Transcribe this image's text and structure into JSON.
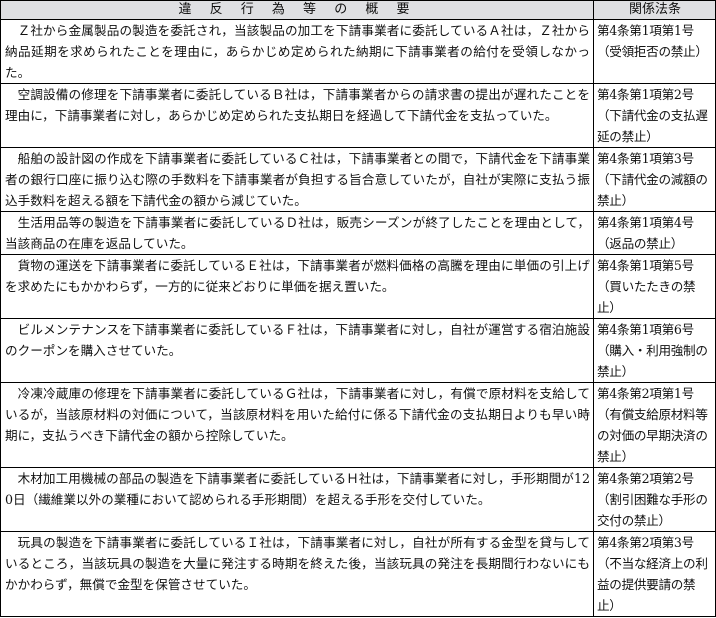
{
  "table": {
    "headers": [
      "違 反 行 為 等 の 概 要",
      "関係法条"
    ],
    "rows": [
      {
        "summary": "Ｚ社から金属製品の製造を委託され，当該製品の加工を下請事業者に委託しているＡ社は，Ｚ社から納品延期を求められたことを理由に，あらかじめ定められた納期に下請事業者の給付を受領しなかった。",
        "law": "第4条第1項第1号（受領拒否の禁止）"
      },
      {
        "summary": "空調設備の修理を下請事業者に委託しているＢ社は，下請事業者からの請求書の提出が遅れたことを理由に，下請事業者に対し，あらかじめ定められた支払期日を経過して下請代金を支払っていた。",
        "law": "第4条第1項第2号（下請代金の支払遅延の禁止）"
      },
      {
        "summary": "船舶の設計図の作成を下請事業者に委託しているＣ社は，下請事業者との間で，下請代金を下請事業者の銀行口座に振り込む際の手数料を下請事業者が負担する旨合意していたが，自社が実際に支払う振込手数料を超える額を下請代金の額から減じていた。",
        "law": "第4条第1項第3号（下請代金の減額の禁止）"
      },
      {
        "summary": "生活用品等の製造を下請事業者に委託しているＤ社は，販売シーズンが終了したことを理由として，当該商品の在庫を返品していた。",
        "law": "第4条第1項第4号（返品の禁止）"
      },
      {
        "summary": "貨物の運送を下請事業者に委託しているＥ社は，下請事業者が燃料価格の高騰を理由に単価の引上げを求めたにもかかわらず，一方的に従来どおりに単価を据え置いた。",
        "law": "第4条第1項第5号（買いたたきの禁止）"
      },
      {
        "summary": "ビルメンテナンスを下請事業者に委託しているＦ社は，下請事業者に対し，自社が運営する宿泊施設のクーポンを購入させていた。",
        "law": "第4条第1項第6号（購入・利用強制の禁止）"
      },
      {
        "summary": "冷凍冷蔵庫の修理を下請事業者に委託しているＧ社は，下請事業者に対し，有償で原材料を支給しているが，当該原材料の対価について，当該原材料を用いた給付に係る下請代金の支払期日よりも早い時期に，支払うべき下請代金の額から控除していた。",
        "law": "第4条第2項第1号（有償支給原材料等の対価の早期決済の禁止）"
      },
      {
        "summary": "木材加工用機械の部品の製造を下請事業者に委託しているＨ社は，下請事業者に対し，手形期間が120日（繊維業以外の業種において認められる手形期間）を超える手形を交付していた。",
        "law": "第4条第2項第2号（割引困難な手形の交付の禁止）"
      },
      {
        "summary": "玩具の製造を下請事業者に委託しているＩ社は，下請事業者に対し，自社が所有する金型を貸与しているところ，当該玩具の製造を大量に発注する時期を終えた後，当該玩具の発注を長期間行わないにもかかわらず，無償で金型を保管させていた。",
        "law": "第4条第2項第3号（不当な経済上の利益の提供要請の禁止）"
      }
    ]
  }
}
